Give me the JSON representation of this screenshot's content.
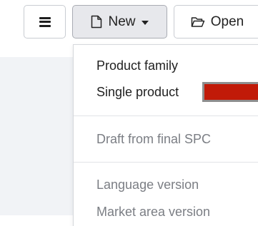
{
  "toolbar": {
    "menu_button_icon": "hamburger-icon",
    "new_button": {
      "label": "New",
      "icon": "document-icon",
      "dropdown_icon": "caret-down-icon"
    },
    "open_button": {
      "label": "Open",
      "icon": "folder-open-icon"
    }
  },
  "new_menu": {
    "items": [
      {
        "label": "Product family",
        "enabled": true
      },
      {
        "label": "Single product",
        "enabled": true
      },
      {
        "label": "Draft from final SPC",
        "enabled": false
      },
      {
        "label": "Language version",
        "enabled": false
      },
      {
        "label": "Market area version",
        "enabled": false
      }
    ],
    "highlight_color": "#c11a08"
  },
  "colors": {
    "panel_background": "#f1f3f6",
    "active_button_background": "#e7e8ec",
    "disabled_text": "#7b7e84"
  }
}
